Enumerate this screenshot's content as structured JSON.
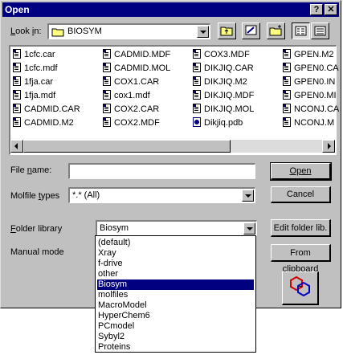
{
  "window": {
    "title": "Open"
  },
  "toolbar": {
    "look_in_label": "Look in:",
    "look_in_value": "BIOSYM",
    "buttons": [
      "up-folder",
      "desktop",
      "new-folder",
      "list-view",
      "details-view"
    ]
  },
  "files": [
    [
      "1cfc.car",
      "1cfc.mdf",
      "1fja.car",
      "1fja.mdf",
      "CADMID.CAR",
      "CADMID.M2"
    ],
    [
      "CADMID.MDF",
      "CADMID.MOL",
      "COX1.CAR",
      "cox1.mdf",
      "COX2.CAR",
      "COX2.MDF"
    ],
    [
      "COX3.MDF",
      "DIKJIQ.CAR",
      "DIKJIQ.M2",
      "DIKJIQ.MDF",
      "DIKJIQ.MOL",
      "Dikjiq.pdb"
    ],
    [
      "GPEN.M2",
      "GPEN0.CA",
      "GPEN0.IN",
      "GPEN0.MI",
      "NCONJ.CA",
      "NCONJ.M"
    ]
  ],
  "form": {
    "file_name_label": "File name:",
    "file_name_value": "",
    "molfile_types_label": "Molfile types",
    "molfile_types_value": "*.* (All)",
    "folder_library_label": "Folder library",
    "folder_library_value": "Biosym",
    "manual_mode_label": "Manual mode"
  },
  "buttons": {
    "open": "Open",
    "cancel": "Cancel",
    "edit_folder_lib": "Edit folder lib.",
    "from_clipboard": "From clipboard"
  },
  "folder_library_options": [
    "(default)",
    "Xray",
    "f-drive",
    "other",
    "Biosym",
    "molfiles",
    "MacroModel",
    "HyperChem6",
    "PCmodel",
    "Sybyl2",
    "Proteins"
  ],
  "selected_folder_library": "Biosym"
}
